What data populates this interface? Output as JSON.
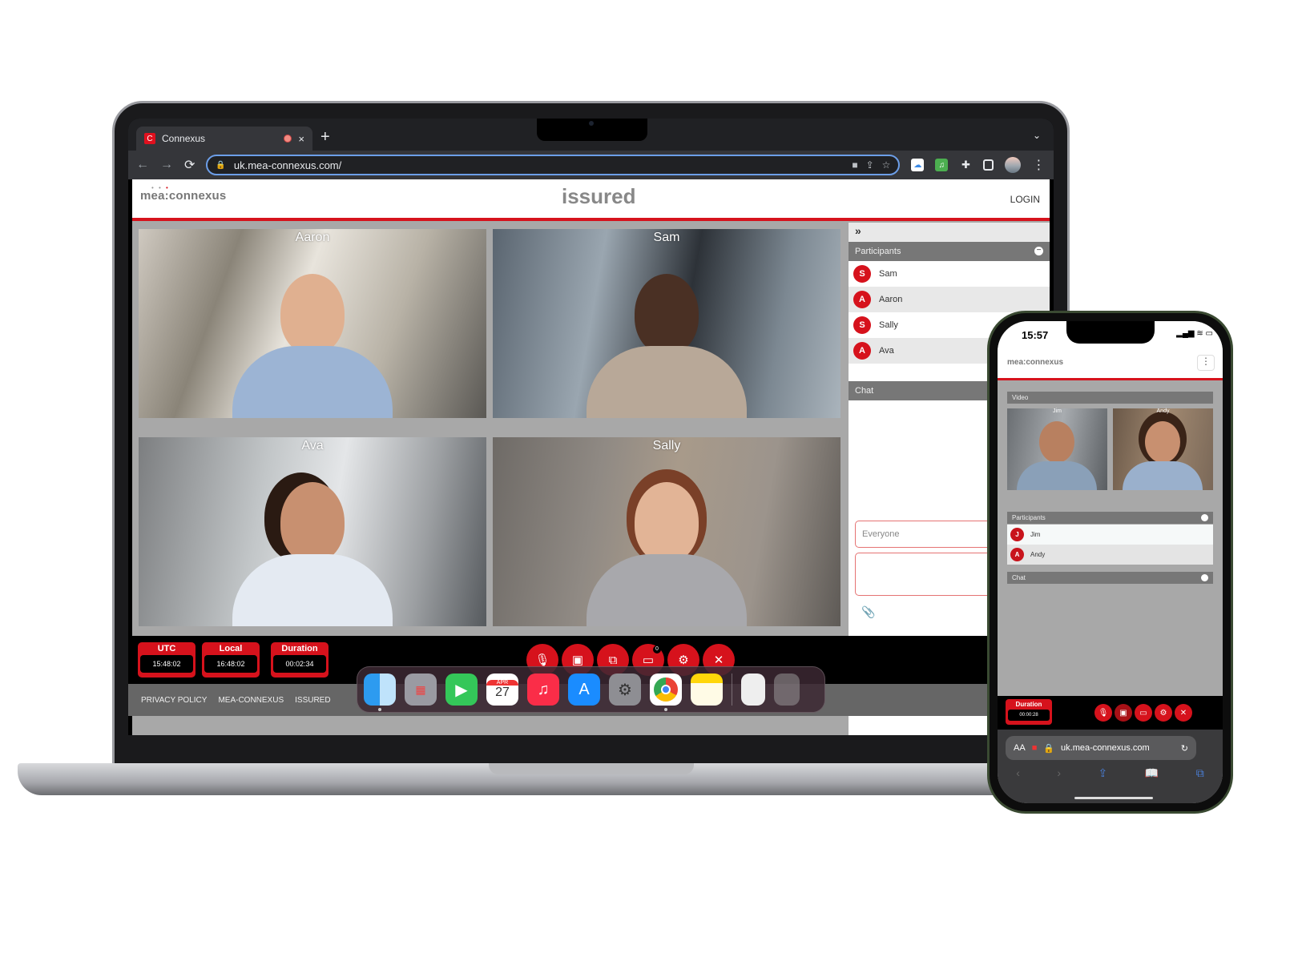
{
  "laptop": {
    "browser": {
      "tab_title": "Connexus",
      "tab_favicon": "C",
      "new_tab_icon": "+",
      "close_icon": "×",
      "url": "uk.mea-connexus.com/",
      "nav": {
        "back": "←",
        "forward": "→",
        "reload": "⟳"
      }
    },
    "page": {
      "logo_left": "mea:connexus",
      "logo_center": "issured",
      "login_label": "LOGIN",
      "video_tiles": [
        {
          "name": "Aaron"
        },
        {
          "name": "Sam"
        },
        {
          "name": "Ava"
        },
        {
          "name": "Sally"
        }
      ],
      "sidebar": {
        "collapse_icon": "»",
        "participants_title": "Participants",
        "participants": [
          {
            "initial": "S",
            "name": "Sam"
          },
          {
            "initial": "A",
            "name": "Aaron"
          },
          {
            "initial": "S",
            "name": "Sally"
          },
          {
            "initial": "A",
            "name": "Ava"
          }
        ],
        "chat_title": "Chat",
        "chat_recipient_placeholder": "Everyone",
        "attach_icon": "📎"
      },
      "clocks": [
        {
          "label": "UTC",
          "value": "15:48:02"
        },
        {
          "label": "Local",
          "value": "16:48:02"
        },
        {
          "label": "Duration",
          "value": "00:02:34"
        }
      ],
      "controls": [
        {
          "name": "mute-mic",
          "glyph": "🎙"
        },
        {
          "name": "stop-video",
          "glyph": "▣"
        },
        {
          "name": "share-screen",
          "glyph": "⧉"
        },
        {
          "name": "chat",
          "glyph": "▭",
          "badge": "0"
        },
        {
          "name": "settings",
          "glyph": "⚙"
        },
        {
          "name": "leave",
          "glyph": "✕"
        }
      ],
      "footer_links": [
        "PRIVACY POLICY",
        "MEA-CONNEXUS",
        "ISSURED"
      ]
    },
    "dock": {
      "apps": [
        "Finder",
        "Launchpad",
        "FaceTime",
        "Calendar",
        "Music",
        "App Store",
        "System Preferences",
        "Chrome",
        "Notes",
        "Archive",
        "Trash"
      ],
      "calendar_month": "APR",
      "calendar_day": "27"
    }
  },
  "phone": {
    "status_time": "15:57",
    "logo": "mea:connexus",
    "video_title": "Video",
    "video_tiles": [
      {
        "name": "Jim"
      },
      {
        "name": "Andy"
      }
    ],
    "participants_title": "Participants",
    "participants": [
      {
        "initial": "J",
        "name": "Jim"
      },
      {
        "initial": "A",
        "name": "Andy"
      }
    ],
    "chat_title": "Chat",
    "duration_label": "Duration",
    "duration_value": "00:00:28",
    "safari_text_size": "AA",
    "url": "uk.mea-connexus.com"
  }
}
